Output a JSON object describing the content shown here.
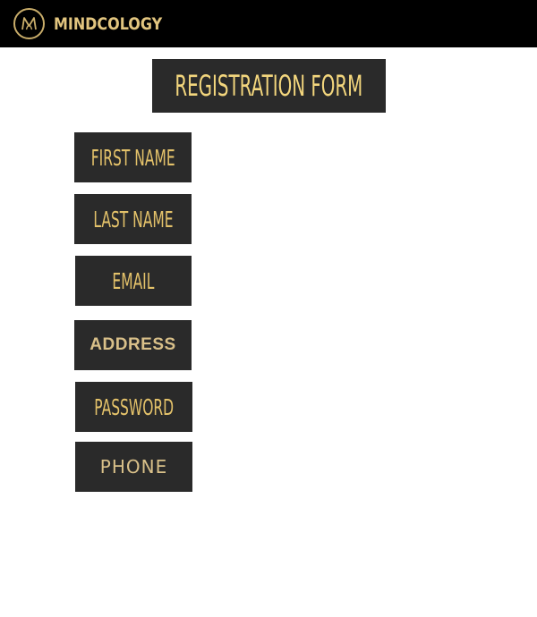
{
  "header": {
    "brand_name": "MINDCOLOGY",
    "logo_icon": "m-monogram-circle-icon"
  },
  "form": {
    "title": "REGISTRATION FORM",
    "fields": [
      {
        "label": "FIRST NAME"
      },
      {
        "label": "LAST NAME"
      },
      {
        "label": "EMAIL"
      },
      {
        "label": "ADDRESS"
      },
      {
        "label": "PASSWORD"
      },
      {
        "label": "PHONE"
      }
    ]
  },
  "colors": {
    "header_bg": "#000000",
    "button_bg": "#2a2a2a",
    "gold": "#e4c26a"
  }
}
